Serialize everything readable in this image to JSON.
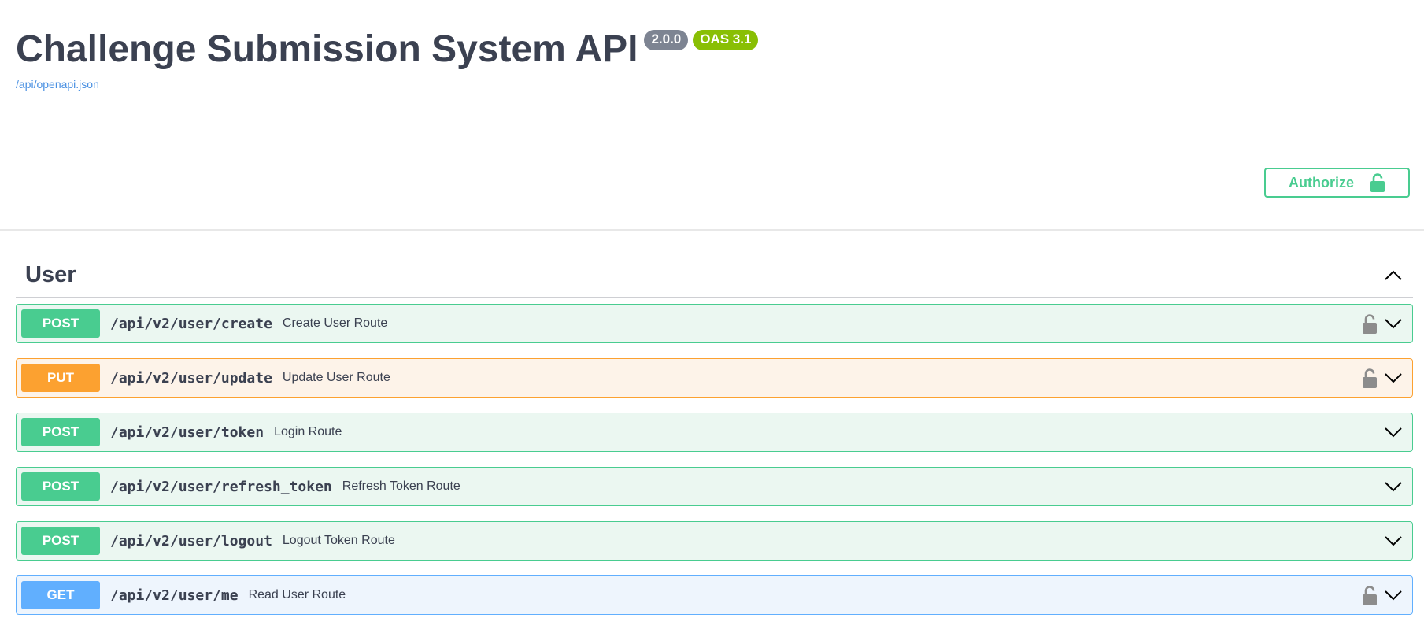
{
  "info": {
    "title": "Challenge Submission System API",
    "version": "2.0.0",
    "oas": "OAS 3.1",
    "spec_link": "/api/openapi.json"
  },
  "authorize": {
    "label": "Authorize",
    "icon": "unlock-icon"
  },
  "section": {
    "title": "User",
    "expanded": true,
    "toggle_icon": "chevron-up-icon"
  },
  "operations": [
    {
      "method": "POST",
      "path": "/api/v2/user/create",
      "summary": "Create User Route",
      "locked": true
    },
    {
      "method": "PUT",
      "path": "/api/v2/user/update",
      "summary": "Update User Route",
      "locked": true
    },
    {
      "method": "POST",
      "path": "/api/v2/user/token",
      "summary": "Login Route",
      "locked": false
    },
    {
      "method": "POST",
      "path": "/api/v2/user/refresh_token",
      "summary": "Refresh Token Route",
      "locked": false
    },
    {
      "method": "POST",
      "path": "/api/v2/user/logout",
      "summary": "Logout Token Route",
      "locked": false
    },
    {
      "method": "GET",
      "path": "/api/v2/user/me",
      "summary": "Read User Route",
      "locked": true
    }
  ],
  "colors": {
    "post": "#49cc90",
    "put": "#fca130",
    "get": "#61affe",
    "title": "#3b4151",
    "link": "#4990e2",
    "version_badge": "#7d8492",
    "oas_badge": "#89bf04"
  }
}
